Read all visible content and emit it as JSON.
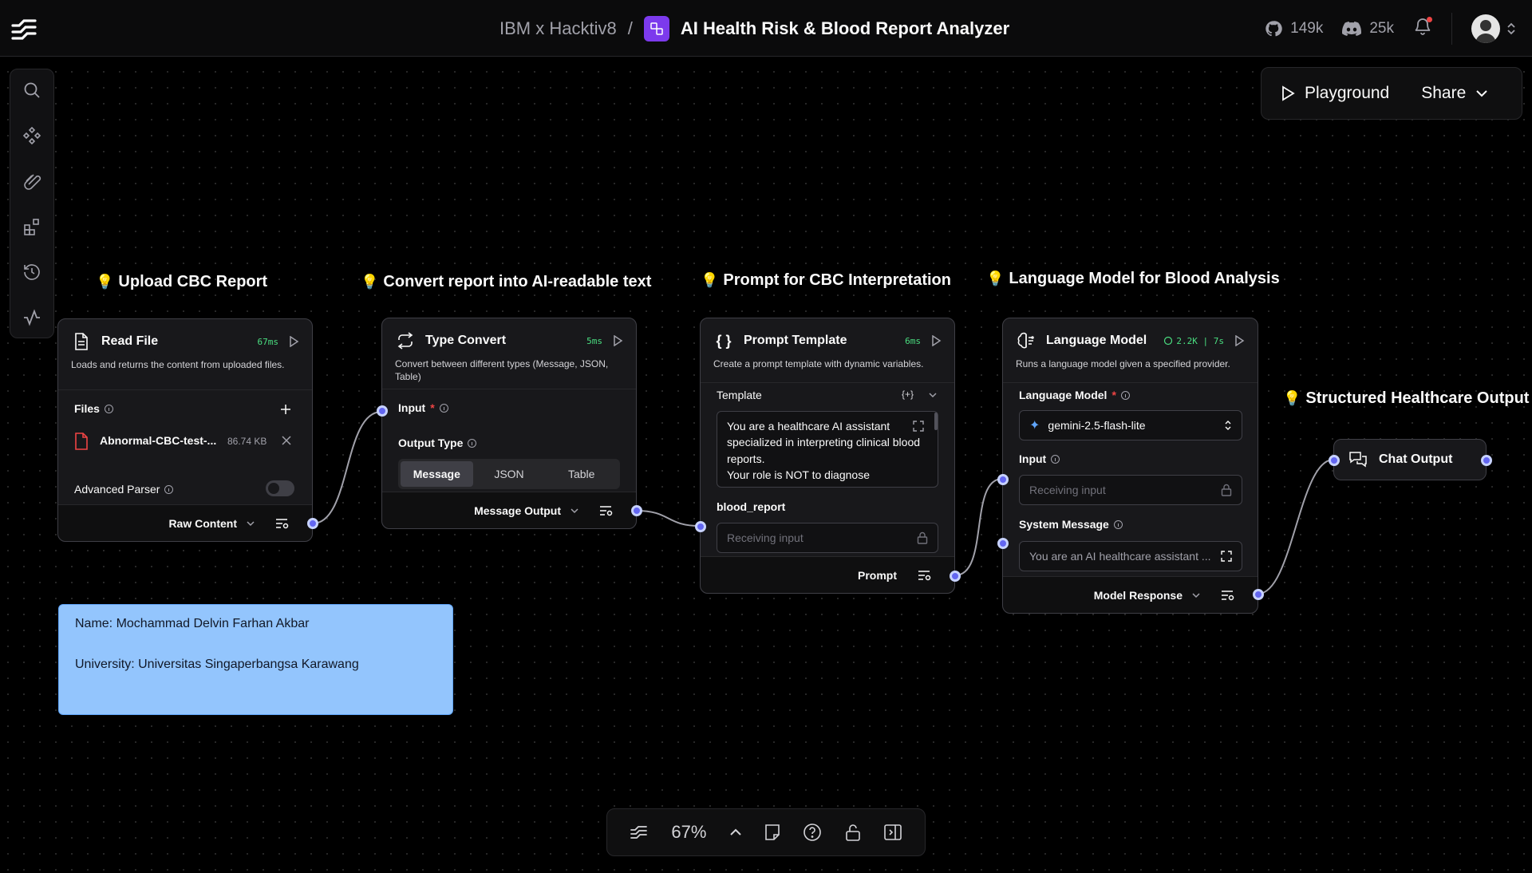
{
  "header": {
    "org": "IBM x Hacktiv8",
    "separator": "/",
    "flow_name": "AI Health Risk & Blood Report Analyzer",
    "github_stars": "149k",
    "discord_members": "25k"
  },
  "actions": {
    "playground": "Playground",
    "share": "Share"
  },
  "notes": [
    "Upload CBC Report",
    "Convert report into AI-readable text",
    "Prompt for CBC Interpretation",
    "Language Model for Blood Analysis",
    "Structured Healthcare Output"
  ],
  "nodes": {
    "read_file": {
      "title": "Read File",
      "time": "67ms",
      "desc": "Loads and returns the content from uploaded files.",
      "files_label": "Files",
      "file_name": "Abnormal-CBC-test-...",
      "file_size": "86.74 KB",
      "advanced_parser": "Advanced Parser",
      "output": "Raw Content"
    },
    "type_convert": {
      "title": "Type Convert",
      "time": "5ms",
      "desc": "Convert between different types (Message, JSON, Table)",
      "input_label": "Input",
      "output_type_label": "Output Type",
      "options": [
        "Message",
        "JSON",
        "Table"
      ],
      "output": "Message Output"
    },
    "prompt_template": {
      "title": "Prompt Template",
      "time": "6ms",
      "desc": "Create a prompt template with dynamic variables.",
      "template_label": "Template",
      "template_text": "You are a healthcare AI assistant specialized in interpreting clinical blood reports.\nYour role is NOT to diagnose",
      "var_label": "blood_report",
      "var_placeholder": "Receiving input",
      "output": "Prompt"
    },
    "language_model": {
      "title": "Language Model",
      "stats": "2.2K | 7s",
      "desc": "Runs a language model given a specified provider.",
      "model_label": "Language Model",
      "model_value": "gemini-2.5-flash-lite",
      "input_label": "Input",
      "input_placeholder": "Receiving input",
      "system_label": "System Message",
      "system_value": "You are an AI healthcare assistant ...",
      "output": "Model Response"
    },
    "chat_output": {
      "title": "Chat Output"
    }
  },
  "sticky": {
    "name": "Name: Mochammad Delvin Farhan Akbar",
    "university": "University: Universitas Singaperbangsa Karawang"
  },
  "toolbar": {
    "zoom": "67%"
  },
  "colors": {
    "accent": "#6366f1",
    "time_green": "#4ade80",
    "brand_purple": "#7c3aed",
    "sticky_blue": "#93c5fd"
  }
}
